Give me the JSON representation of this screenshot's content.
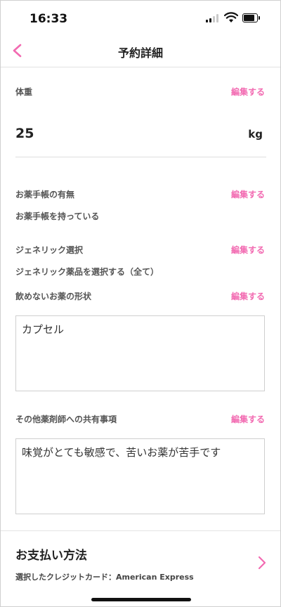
{
  "status_bar": {
    "time": "16:33"
  },
  "nav": {
    "title": "予約詳細"
  },
  "weight": {
    "label": "体重",
    "edit_label": "編集する",
    "value": "25",
    "unit": "kg"
  },
  "medication_notebook": {
    "label": "お薬手帳の有無",
    "edit_label": "編集する",
    "value": "お薬手帳を持っている"
  },
  "generic_selection": {
    "label": "ジェネリック選択",
    "edit_label": "編集する",
    "value": "ジェネリック薬品を選択する（全て）"
  },
  "medicine_form": {
    "label": "飲めないお薬の形状",
    "edit_label": "編集する",
    "value": "カプセル"
  },
  "pharmacist_notes": {
    "label": "その他薬剤師への共有事項",
    "edit_label": "編集する",
    "value": "味覚がとても敏感で、苦いお薬が苦手です"
  },
  "payment": {
    "title": "お支払い方法",
    "card_text": "選択したクレジットカード：American Express"
  },
  "colors": {
    "accent": "#f26ab1",
    "text": "#222222",
    "label": "#555555"
  }
}
